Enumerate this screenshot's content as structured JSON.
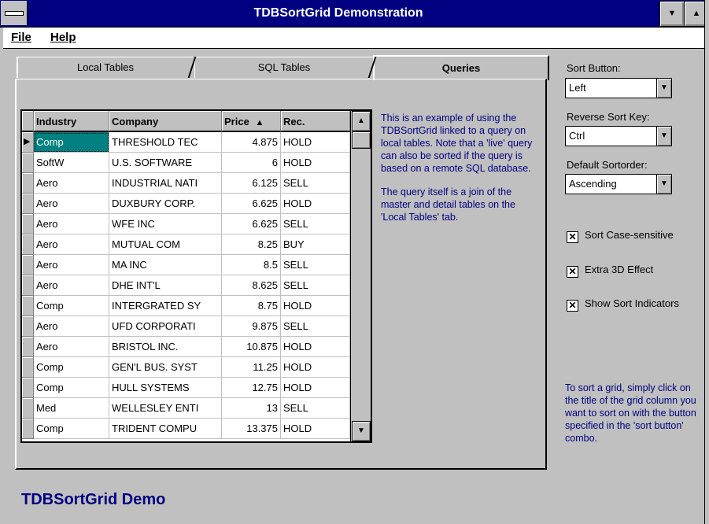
{
  "window": {
    "title": "TDBSortGrid Demonstration"
  },
  "menu": {
    "items": [
      "File",
      "Help"
    ]
  },
  "tabs": [
    {
      "label": "Local Tables",
      "active": false
    },
    {
      "label": "SQL Tables",
      "active": false
    },
    {
      "label": "Queries",
      "active": true
    }
  ],
  "grid": {
    "columns": [
      "Industry",
      "Company",
      "Price",
      "Rec."
    ],
    "sorted_column": "Price",
    "sort_direction": "ascending",
    "rows": [
      [
        "Comp",
        "THRESHOLD TEC",
        "4.875",
        "HOLD"
      ],
      [
        "SoftW",
        "U.S. SOFTWARE",
        "6",
        "HOLD"
      ],
      [
        "Aero",
        "INDUSTRIAL NATI",
        "6.125",
        "SELL"
      ],
      [
        "Aero",
        "DUXBURY CORP.",
        "6.625",
        "HOLD"
      ],
      [
        "Aero",
        "WFE INC",
        "6.625",
        "SELL"
      ],
      [
        "Aero",
        "MUTUAL COM",
        "8.25",
        "BUY"
      ],
      [
        "Aero",
        "MA INC",
        "8.5",
        "SELL"
      ],
      [
        "Aero",
        "DHE INT'L",
        "8.625",
        "SELL"
      ],
      [
        "Comp",
        "INTERGRATED SY",
        "8.75",
        "HOLD"
      ],
      [
        "Aero",
        "UFD CORPORATI",
        "9.875",
        "SELL"
      ],
      [
        "Aero",
        "BRISTOL INC.",
        "10.875",
        "HOLD"
      ],
      [
        "Comp",
        "GEN'L BUS. SYST",
        "11.25",
        "HOLD"
      ],
      [
        "Comp",
        "HULL SYSTEMS",
        "12.75",
        "HOLD"
      ],
      [
        "Med",
        "WELLESLEY ENTI",
        "13",
        "SELL"
      ],
      [
        "Comp",
        "TRIDENT COMPU",
        "13.375",
        "HOLD"
      ]
    ]
  },
  "description": {
    "p1": "This is an example of using the TDBSortGrid linked to a query on local tables. Note that a 'live' query can also be sorted if the query is based on a remote SQL database.",
    "p2": "The query itself is a join of the master and detail tables on the 'Local Tables' tab."
  },
  "options": {
    "sort_button": {
      "label": "Sort Button:",
      "value": "Left"
    },
    "reverse_sort_key": {
      "label": "Reverse Sort Key:",
      "value": "Ctrl"
    },
    "default_sortorder": {
      "label": "Default Sortorder:",
      "value": "Ascending"
    },
    "checkboxes": [
      {
        "label": "Sort Case-sensitive",
        "checked": true
      },
      {
        "label": "Extra 3D Effect",
        "checked": true
      },
      {
        "label": "Show Sort Indicators",
        "checked": true
      }
    ]
  },
  "hint": "To sort a grid, simply click on the title of the grid column you want to sort on with the button specified in the 'sort button' combo.",
  "footer": {
    "title": "TDBSortGrid Demo"
  },
  "colors": {
    "title_bar": "#000080",
    "selection": "#008080",
    "info_text": "#000080",
    "face": "#c0c0c0"
  }
}
